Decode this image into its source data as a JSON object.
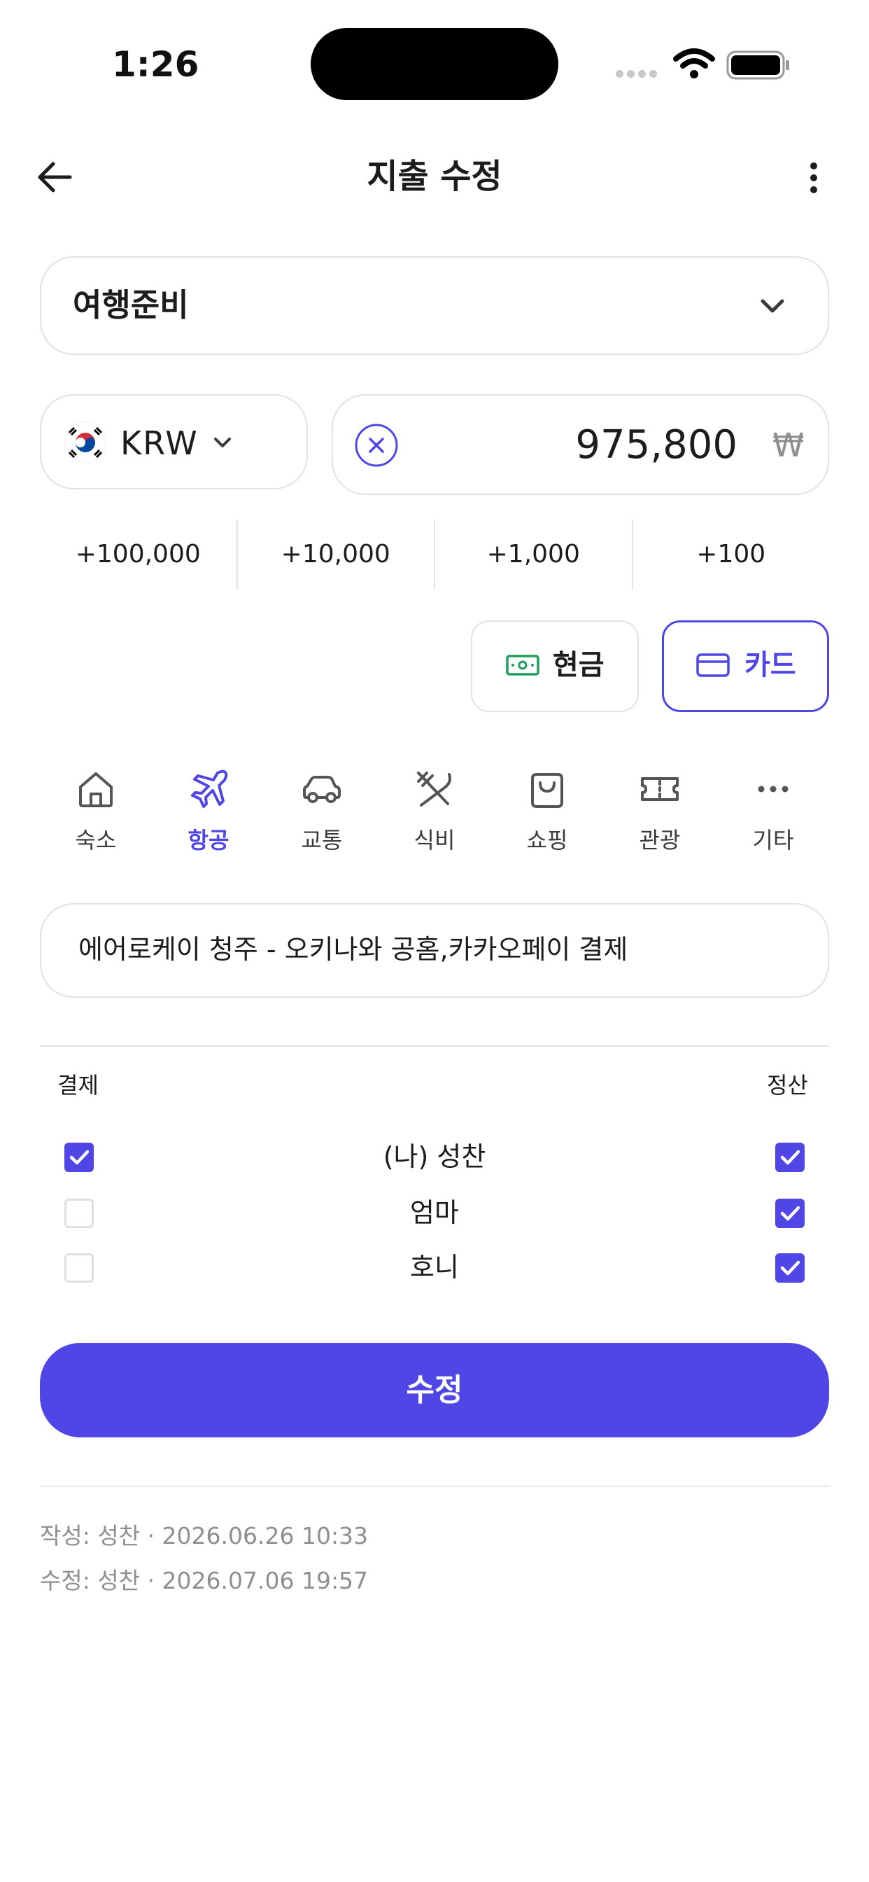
{
  "status_bar": {
    "time": "1:26"
  },
  "header": {
    "title": "지출 수정"
  },
  "category_select": {
    "value": "여행준비"
  },
  "currency": {
    "code": "KRW"
  },
  "amount": {
    "value": "975,800",
    "symbol": "₩"
  },
  "quick_add": [
    "+100,000",
    "+10,000",
    "+1,000",
    "+100"
  ],
  "payment_method": {
    "cash_label": "현금",
    "card_label": "카드",
    "selected": "카드"
  },
  "categories": [
    {
      "label": "숙소",
      "icon": "home-icon"
    },
    {
      "label": "항공",
      "icon": "airplane-icon",
      "selected": true
    },
    {
      "label": "교통",
      "icon": "car-icon"
    },
    {
      "label": "식비",
      "icon": "utensils-icon"
    },
    {
      "label": "쇼핑",
      "icon": "shopping-bag-icon"
    },
    {
      "label": "관광",
      "icon": "ticket-icon"
    },
    {
      "label": "기타",
      "icon": "more-horizontal-icon"
    }
  ],
  "memo": {
    "value": "에어로케이 청주 - 오키나와 공홈,카카오페이 결제"
  },
  "split": {
    "pay_header": "결제",
    "settle_header": "정산",
    "members": [
      {
        "name": "(나) 성찬",
        "paid": true,
        "settle": true
      },
      {
        "name": "엄마",
        "paid": false,
        "settle": true
      },
      {
        "name": "호니",
        "paid": false,
        "settle": true
      }
    ]
  },
  "submit_label": "수정",
  "meta": {
    "created": "작성: 성찬 · 2026.06.26 10:33",
    "modified": "수정: 성찬 · 2026.07.06 19:57"
  },
  "colors": {
    "accent": "#4f46e5",
    "cash_green": "#1e9e5a",
    "border": "#e2e2e6",
    "muted_text": "#8e8e93"
  }
}
